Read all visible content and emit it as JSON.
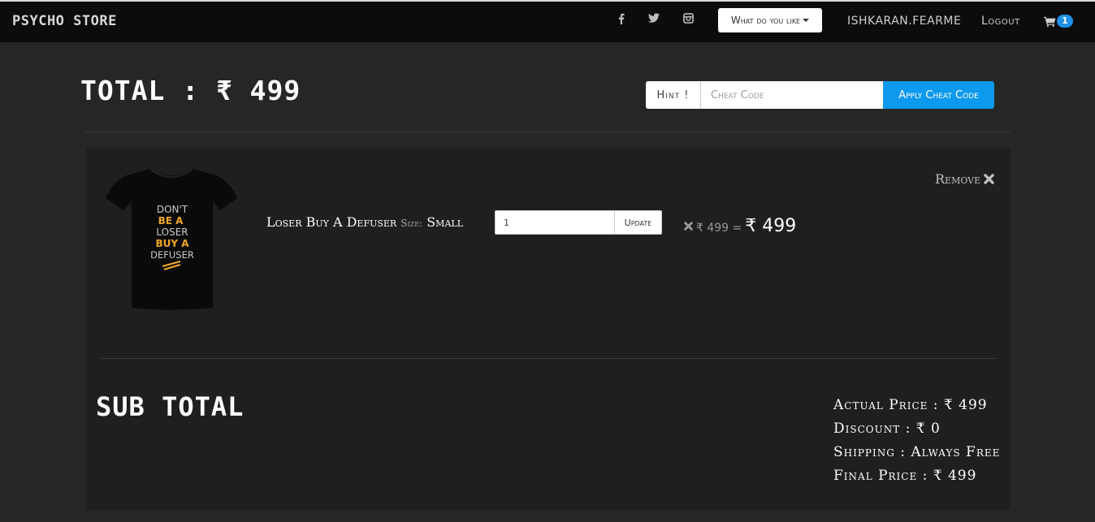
{
  "brand": "PSYCHO STORE",
  "nav": {
    "social": [
      "facebook-icon",
      "twitter-icon",
      "instagram-icon"
    ],
    "dropdown_label": "What do you like",
    "user": "ISHKARAN.FEARME",
    "logout": "Logout",
    "cart_count": "1"
  },
  "header": {
    "total_label": "TOTAL : ₹ 499"
  },
  "cheat": {
    "hint_label": "Hint !",
    "placeholder": "Cheat Code",
    "apply_label": "Apply Cheat Code"
  },
  "cart_item": {
    "name": "Loser Buy A Defuser",
    "size_label": "Size:",
    "size_value": "Small",
    "quantity": "1",
    "update_label": "Update",
    "unit_price": "₹ 499 =",
    "line_total": "₹ 499",
    "remove_label": "Remove"
  },
  "subtotal": {
    "heading": "SUB TOTAL",
    "actual_price": "Actual Price : ₹ 499",
    "discount": "Discount : ₹ 0",
    "shipping": "Shipping : Always Free",
    "final_price": "Final Price : ₹ 499"
  },
  "colors": {
    "accent": "#0d99ee",
    "page_bg": "#262626",
    "panel_bg": "#1f1f1f",
    "nav_bg": "#0c0c0c"
  }
}
